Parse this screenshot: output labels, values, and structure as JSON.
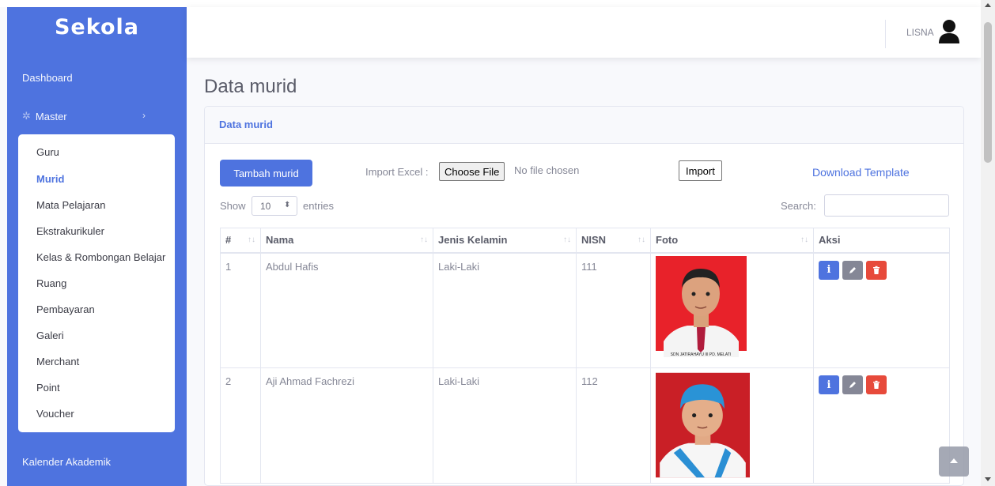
{
  "app": {
    "brand": "Sekola"
  },
  "sidebar": {
    "dashboard": "Dashboard",
    "master": {
      "label": "Master",
      "icon": "gear-icon",
      "chevron": "›"
    },
    "submenu": [
      {
        "label": "Guru",
        "active": false
      },
      {
        "label": "Murid",
        "active": true
      },
      {
        "label": "Mata Pelajaran",
        "active": false
      },
      {
        "label": "Ekstrakurikuler",
        "active": false
      },
      {
        "label": "Kelas & Rombongan Belajar",
        "active": false
      },
      {
        "label": "Ruang",
        "active": false
      },
      {
        "label": "Pembayaran",
        "active": false
      },
      {
        "label": "Galeri",
        "active": false
      },
      {
        "label": "Merchant",
        "active": false
      },
      {
        "label": "Point",
        "active": false
      },
      {
        "label": "Voucher",
        "active": false
      }
    ],
    "kalender": "Kalender Akademik"
  },
  "topbar": {
    "user_name": "LISNA",
    "avatar_icon": "user-icon"
  },
  "page": {
    "title": "Data murid"
  },
  "card": {
    "title": "Data murid",
    "add_button": "Tambah murid",
    "import_label": "Import Excel :",
    "file_button": "Choose File",
    "file_status": "No file chosen",
    "import_button": "Import",
    "download_link": "Download Template",
    "show_label": "Show",
    "entries_value": "10",
    "entries_label": "entries",
    "search_label": "Search:"
  },
  "table": {
    "headers": [
      "#",
      "Nama",
      "Jenis Kelamin",
      "NISN",
      "Foto",
      "Aksi"
    ],
    "rows": [
      {
        "no": "1",
        "nama": "Abdul Hafis",
        "jk": "Laki-Laki",
        "nisn": "111",
        "photo_caption": "SDN JATIRAHAYU III PD. MELATI"
      },
      {
        "no": "2",
        "nama": "Aji Ahmad Fachrezi",
        "jk": "Laki-Laki",
        "nisn": "112",
        "photo_caption": ""
      }
    ]
  },
  "colors": {
    "primary": "#4e73df",
    "danger": "#e74a3b",
    "secondary": "#858796"
  },
  "chart_data": {}
}
